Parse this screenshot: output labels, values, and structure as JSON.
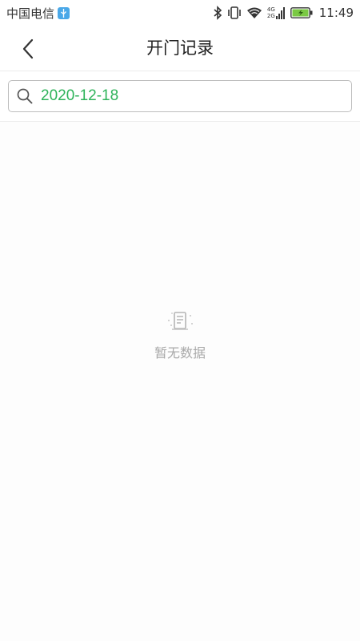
{
  "status_bar": {
    "carrier": "中国电信",
    "network_top": "4G",
    "network_bottom": "2G",
    "time": "11:49",
    "icons": [
      "usb-icon",
      "bluetooth-icon",
      "vibrate-icon",
      "wifi-icon",
      "signal-icon",
      "battery-charging-icon"
    ]
  },
  "header": {
    "title": "开门记录",
    "back_icon": "chevron-left-icon"
  },
  "search": {
    "value": "2020-12-18",
    "icon": "search-icon",
    "accent_color": "#2eb35a"
  },
  "empty_state": {
    "icon": "empty-document-icon",
    "text": "暂无数据"
  }
}
